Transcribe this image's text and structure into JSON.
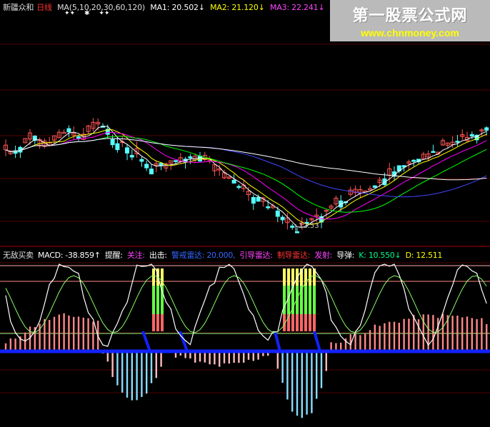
{
  "upper": {
    "stock_name": "新疆众和",
    "period": "日线",
    "ma_def": "MA(5,10,20,30,60,120)",
    "ma1": "MA1: 20.502↓",
    "ma2": "MA2: 21.120↓",
    "ma3": "MA3: 22.241↓",
    "markers": [
      "✦✦",
      "✱",
      "✦✦"
    ],
    "low_price": "12.53"
  },
  "lower": {
    "indicator_name": "无敌买卖",
    "macd": "MACD: -38.859↑",
    "remind": "提醒:",
    "focus": "关注:",
    "exit": "出击:",
    "radar1": "警戒雷达: 20.000,",
    "radar2": "引导雷达:",
    "radar3": "制导雷达:",
    "launch": "发射:",
    "missile": "导弹:",
    "k": "K: 10.550↓",
    "d": "D: 12.511"
  },
  "watermark": {
    "title": "第一股票公式网",
    "url": "www.chnmoney.com"
  },
  "colors": {
    "bg": "#000000",
    "up": "#ff5555",
    "down": "#55ffff",
    "ma1": "#ffffff",
    "ma2": "#ffff00",
    "ma3": "#ff00ff",
    "ma4": "#00ff00",
    "ma5": "#4444ff",
    "red_label": "#ff3333",
    "magenta_label": "#ff44ff",
    "blue_label": "#3366ff",
    "green_label": "#00ff88"
  }
}
